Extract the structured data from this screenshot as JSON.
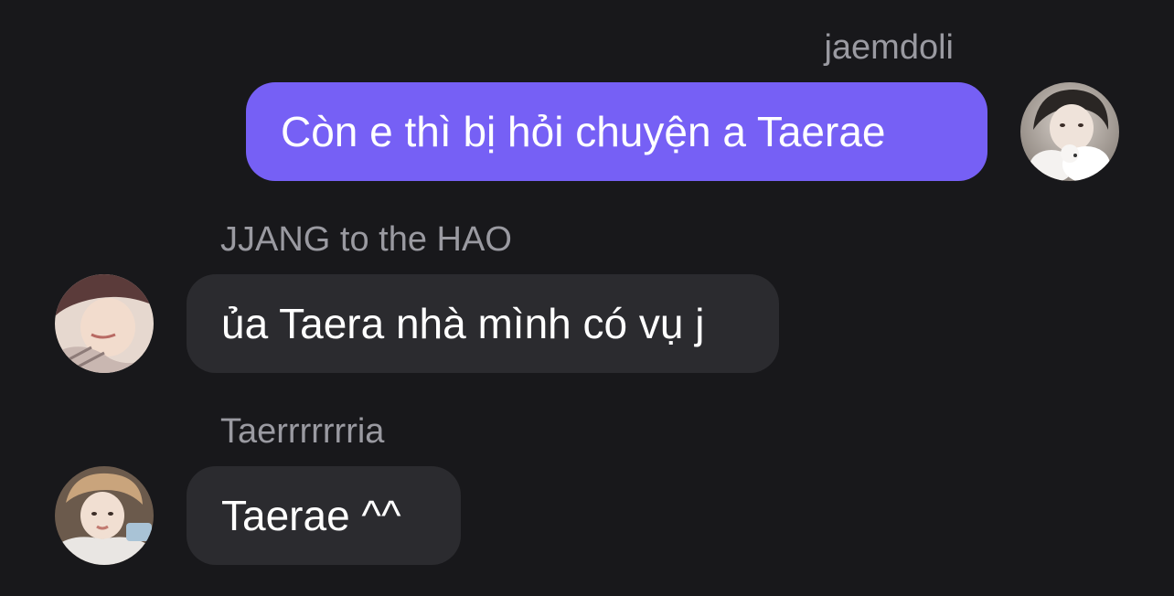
{
  "messages": [
    {
      "direction": "outgoing",
      "sender": "jaemdoli",
      "text": "Còn e thì bị hỏi chuyện a Taerae",
      "bubble_color": "#7660f5"
    },
    {
      "direction": "incoming",
      "sender": "JJANG to the HAO",
      "text": "ủa Taera nhà mình có vụ j",
      "bubble_color": "#2b2b2f"
    },
    {
      "direction": "incoming",
      "sender": "Taerrrrrrria",
      "text": "Taerae ^^",
      "bubble_color": "#2b2b2f"
    }
  ],
  "theme": {
    "background": "#18181b",
    "sender_name_color": "#9a9aa1",
    "text_color": "#ffffff"
  }
}
